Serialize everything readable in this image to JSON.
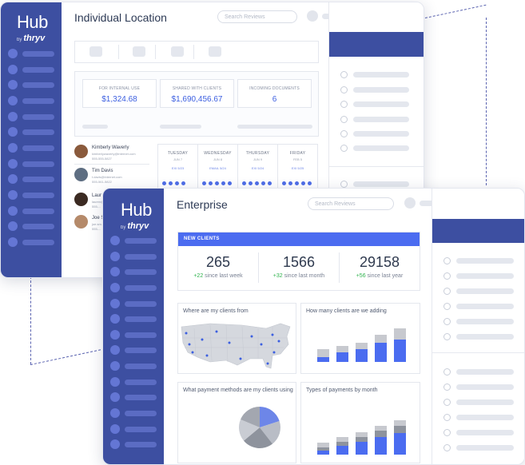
{
  "back_window": {
    "logo": {
      "hub": "Hub",
      "by": "by",
      "thryv": "thryv"
    },
    "title": "Individual Location",
    "search_placeholder": "Search Reviews",
    "stats": [
      {
        "label": "FOR INTERNAL USE",
        "value": "$1,324.68"
      },
      {
        "label": "SHARED WITH CLIENTS",
        "value": "$1,690,456.67"
      },
      {
        "label": "INCOMING DOCUMENTS",
        "value": "6"
      }
    ],
    "contacts": [
      {
        "name": "Kimberly Waverly",
        "email": "kimberlywaverly@internet.com",
        "phone": "555-555-5827"
      },
      {
        "name": "Tim Davis",
        "email": "t.davis@internet.com",
        "phone": "555-561-5822"
      },
      {
        "name": "Laur",
        "email": "lauren@...",
        "phone": "555-..."
      },
      {
        "name": "Joe S",
        "email": "joe.sm...",
        "phone": "555-..."
      }
    ],
    "calendar": [
      {
        "day": "TUESDAY",
        "date": "JUN 7",
        "link": "EXI 5/23"
      },
      {
        "day": "WEDNESDAY",
        "date": "JUN 8",
        "link": "EMAIL 5/24"
      },
      {
        "day": "THURSDAY",
        "date": "JUN 9",
        "link": "EXI 5/24"
      },
      {
        "day": "FRIDAY",
        "date": "FEB 5",
        "link": "EXI 5/25"
      }
    ]
  },
  "front_window": {
    "logo": {
      "hub": "Hub",
      "by": "by",
      "thryv": "thryv"
    },
    "title": "Enterprise",
    "search_placeholder": "Search Reviews",
    "new_clients": {
      "header": "NEW CLIENTS",
      "items": [
        {
          "value": "265",
          "delta": "+22",
          "period": " since last week"
        },
        {
          "value": "1566",
          "delta": "+32",
          "period": " since last month"
        },
        {
          "value": "29158",
          "delta": "+56",
          "period": " since last year"
        }
      ]
    },
    "cards": {
      "map_title": "Where are my clients from",
      "adding_title": "How many clients are we adding",
      "payment_methods_title": "What payment methods are my clients using",
      "payment_types_title": "Types of payments by month"
    },
    "colors": {
      "sidebar": "#3d4fa1",
      "accent": "#4b6cf0",
      "positive": "#2fb34e"
    }
  }
}
